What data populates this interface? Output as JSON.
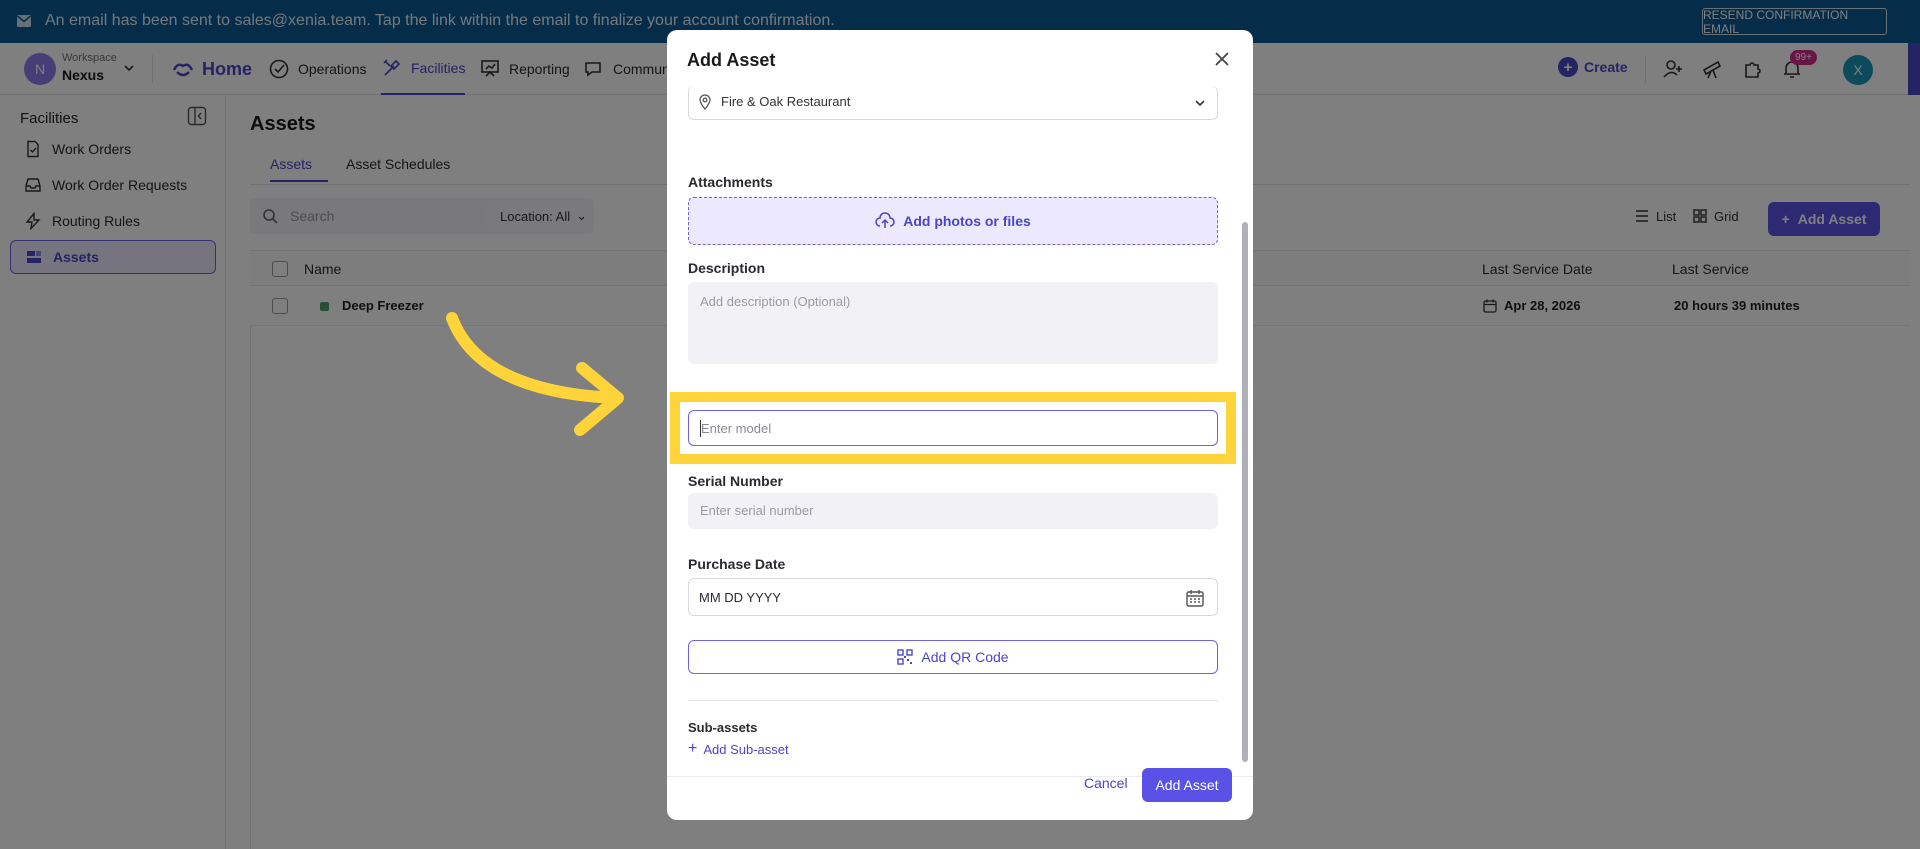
{
  "banner": {
    "message": "An email has been sent to sales@xenia.team. Tap the link within the email to finalize your account confirmation.",
    "resend_label": "RESEND CONFIRMATION EMAIL"
  },
  "workspace": {
    "label": "Workspace",
    "name": "Nexus",
    "initial": "N"
  },
  "nav": {
    "home": "Home",
    "operations": "Operations",
    "facilities": "Facilities",
    "reporting": "Reporting",
    "communication": "Commun",
    "create": "Create",
    "notification_count": "99+",
    "user_initial": "X"
  },
  "sidebar": {
    "title": "Facilities",
    "items": [
      {
        "label": "Work Orders",
        "icon": "file-icon"
      },
      {
        "label": "Work Order Requests",
        "icon": "inbox-icon"
      },
      {
        "label": "Routing Rules",
        "icon": "lightning-icon"
      },
      {
        "label": "Assets",
        "icon": "assets-icon"
      }
    ]
  },
  "main": {
    "title": "Assets",
    "tabs": [
      "Assets",
      "Asset Schedules"
    ],
    "search_placeholder": "Search",
    "location_filter": "Location: All",
    "view_list": "List",
    "view_grid": "Grid",
    "add_asset": "Add Asset",
    "columns": [
      "Name",
      "Last Service Date",
      "Last Service"
    ],
    "rows": [
      {
        "name": "Deep Freezer",
        "last_service_date": "Apr 28, 2026",
        "last_service": "20 hours 39 minutes"
      }
    ]
  },
  "modal": {
    "title": "Add Asset",
    "location_value": "Fire & Oak Restaurant",
    "attachments_label": "Attachments",
    "attachments_button": "Add photos or files",
    "description_label": "Description",
    "description_placeholder": "Add description (Optional)",
    "model_placeholder": "Enter model",
    "serial_label": "Serial Number",
    "serial_placeholder": "Enter serial number",
    "purchase_label": "Purchase Date",
    "purchase_placeholder": "MM DD YYYY",
    "qr_button": "Add QR Code",
    "subassets_label": "Sub-assets",
    "add_subasset": "Add Sub-asset",
    "cancel": "Cancel",
    "submit": "Add Asset"
  },
  "colors": {
    "accent": "#5a52e6",
    "banner": "#0a5a93",
    "highlight": "#ffd43b"
  }
}
